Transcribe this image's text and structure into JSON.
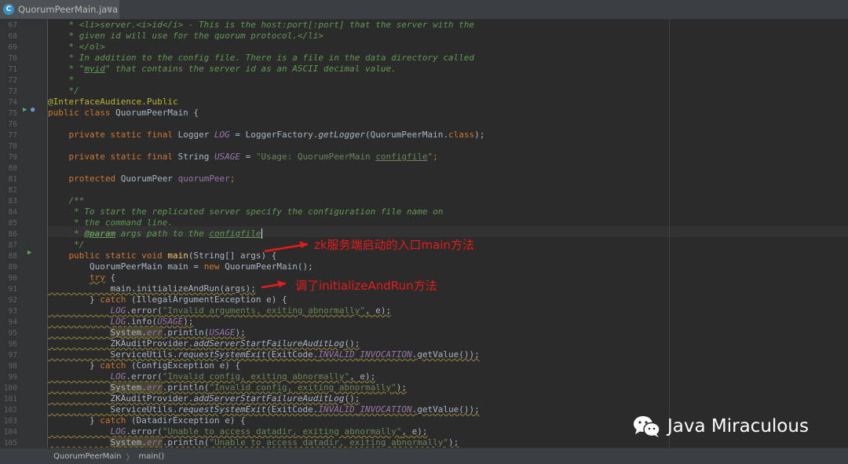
{
  "tab": {
    "filename": "QuorumPeerMain.java",
    "icon": "C",
    "close": "×"
  },
  "breadcrumb": {
    "class_name": "QuorumPeerMain",
    "separator": "〉",
    "method": "main()"
  },
  "annotations": {
    "entry_point": "zk服务端启动的入口main方法",
    "call_note": "调了initializeAndRun方法"
  },
  "watermark": {
    "text": "Java Miraculous",
    "icon": "wechat-icon"
  },
  "colors": {
    "keyword": "#cc7832",
    "comment": "#629755",
    "string": "#6a8759",
    "field": "#9876aa",
    "annotation_arrow": "#e81b1b",
    "background": "#2b2b2b"
  },
  "line_numbers": [
    "67",
    "68",
    "69",
    "70",
    "71",
    "72",
    "73",
    "74",
    "75",
    "76",
    "77",
    "78",
    "79",
    "80",
    "81",
    "82",
    "83",
    "84",
    "85",
    "86",
    "87",
    "88",
    "89",
    "90",
    "91",
    "92",
    "93",
    "94",
    "95",
    "96",
    "97",
    "98",
    "99",
    "100",
    "101",
    "102",
    "103",
    "104",
    "105"
  ],
  "code": {
    "l67a": "    * <li>server.<i>id</i> - This is the host:port[:port] that the server with the",
    "l68a": "    * given id will use for the quorum protocol.</li>",
    "l69a": "    * </ol>",
    "l70a": "    * In addition to the config file. There is a file in the data directory called",
    "l71a": "    * \"",
    "l71b": "myid",
    "l71c": "\" that contains the server id as an ASCII decimal value.",
    "l72a": "    *",
    "l73a": "    */",
    "l74a": "@InterfaceAudience.Public",
    "l75a": "public class ",
    "l75b": "QuorumPeerMain {",
    "l77a": "    private static final ",
    "l77b": "Logger ",
    "l77c": "LOG",
    "l77d": " = LoggerFactory.",
    "l77e": "getLogger",
    "l77f": "(QuorumPeerMain.",
    "l77g": "class",
    "l77h": ");",
    "l79a": "    private static final ",
    "l79b": "String ",
    "l79c": "USAGE",
    "l79d": " = ",
    "l79e": "\"Usage: QuorumPeerMain ",
    "l79f": "configfile",
    "l79g": "\"",
    "l79h": ";",
    "l81a": "    protected ",
    "l81b": "QuorumPeer ",
    "l81c": "quorumPeer",
    "l81d": ";",
    "l83a": "    /**",
    "l84a": "     * To start the replicated server specify the configuration file name on",
    "l85a": "     * the command line.",
    "l86a": "     * ",
    "l86b": "@param",
    "l86c": " args path to the ",
    "l86d": "configfile",
    "l87a": "     */",
    "l88a": "    public static void ",
    "l88b": "main",
    "l88c": "(String[] args) {",
    "l89a": "        QuorumPeerMain main = ",
    "l89b": "new ",
    "l89c": "QuorumPeerMain();",
    "l90a": "        ",
    "l90b": "try",
    "l90c": " {",
    "l91a": "            main.initializeAndRun(args);",
    "l92a": "        } ",
    "l92b": "catch",
    "l92c": " (IllegalArgumentException e) {",
    "l93a": "            ",
    "l93b": "LOG",
    "l93c": ".error(",
    "l93d": "\"Invalid arguments, exiting abnormally\"",
    "l93e": ", e);",
    "l94a": "            ",
    "l94b": "LOG",
    "l94c": ".info(",
    "l94d": "USAGE",
    "l94e": ");",
    "l95a": "            ",
    "l95b": "System.",
    "l95c": "err",
    "l95d": ".println(",
    "l95e": "USAGE",
    "l95f": ");",
    "l96a": "            ZKAuditProvider.",
    "l96b": "addServerStartFailureAuditLog",
    "l96c": "();",
    "l97a": "            ServiceUtils.",
    "l97b": "requestSystemExit",
    "l97c": "(ExitCode.",
    "l97d": "INVALID_INVOCATION",
    "l97e": ".getValue());",
    "l98a": "        } ",
    "l98b": "catch",
    "l98c": " (ConfigException e) {",
    "l99a": "            ",
    "l99b": "LOG",
    "l99c": ".error(",
    "l99d": "\"Invalid config, exiting abnormally\"",
    "l99e": ", e);",
    "l100a": "            ",
    "l100b": "System.",
    "l100c": "err",
    "l100d": ".println(",
    "l100e": "\"Invalid config, exiting abnormally\"",
    "l100f": ");",
    "l101a": "            ZKAuditProvider.",
    "l101b": "addServerStartFailureAuditLog",
    "l101c": "();",
    "l102a": "            ServiceUtils.",
    "l102b": "requestSystemExit",
    "l102c": "(ExitCode.",
    "l102d": "INVALID_INVOCATION",
    "l102e": ".getValue());",
    "l103a": "        } ",
    "l103b": "catch",
    "l103c": " (DatadirException e) {",
    "l104a": "            ",
    "l104b": "LOG",
    "l104c": ".error(",
    "l104d": "\"Unable to access datadir, exiting abnormally\"",
    "l104e": ", e);",
    "l105a": "            ",
    "l105b": "System.",
    "l105c": "err",
    "l105d": ".println(",
    "l105e": "\"Unable to access datadir, exiting abnormally\"",
    "l105f": ");"
  }
}
